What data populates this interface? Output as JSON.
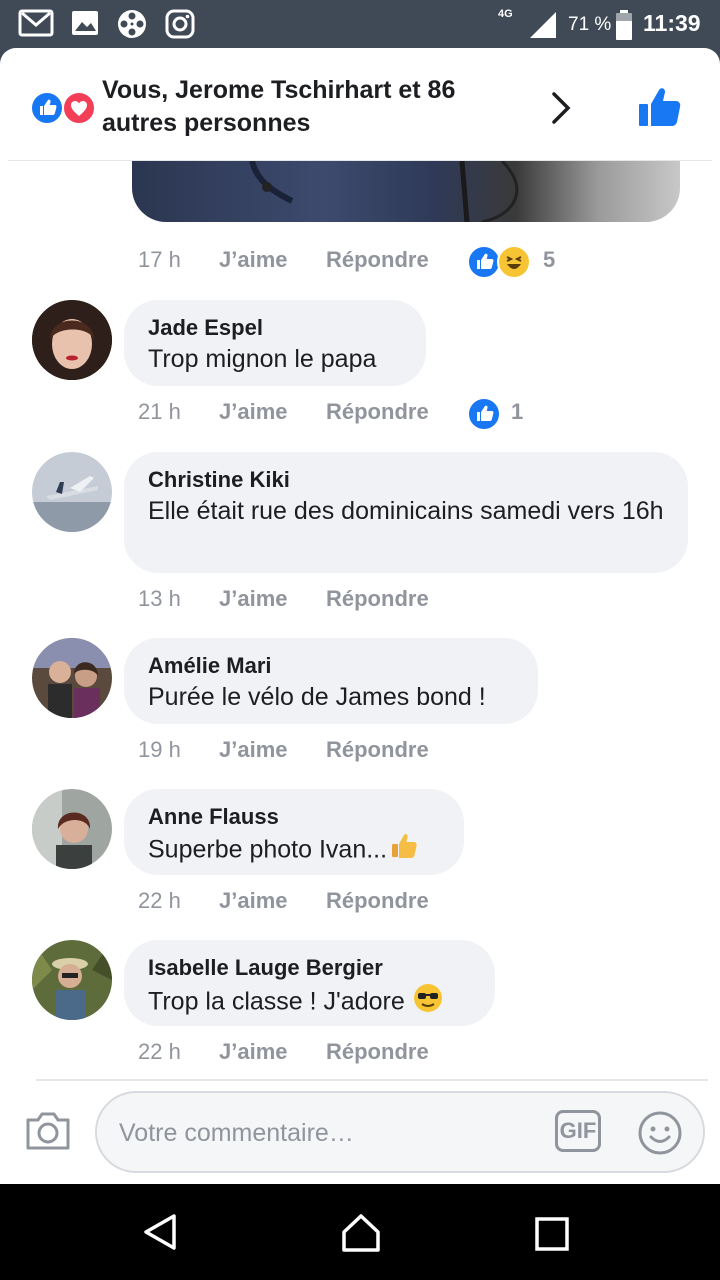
{
  "status_bar": {
    "network": "4G",
    "battery": "71 %",
    "time": "11:39",
    "icons": [
      "gmail-icon",
      "gallery-icon",
      "film-reel-icon",
      "instagram-icon",
      "signal-icon",
      "battery-icon"
    ]
  },
  "header": {
    "reactors_text": "Vous, Jerome Tschirhart et 86 autres personnes",
    "reaction_icons": [
      "like-icon",
      "love-icon"
    ]
  },
  "post_meta": {
    "time": "17 h",
    "like_label": "J’aime",
    "reply_label": "Répondre",
    "reaction_count": "5"
  },
  "comments": [
    {
      "name": "Jade Espel",
      "text": "Trop mignon le papa",
      "time": "21 h",
      "like_label": "J’aime",
      "reply_label": "Répondre",
      "reaction_count": "1"
    },
    {
      "name": "Christine Kiki",
      "text": "Elle était rue des dominicains samedi vers 16h",
      "time": "13 h",
      "like_label": "J’aime",
      "reply_label": "Répondre"
    },
    {
      "name": "Amélie Mari",
      "text": "Purée le vélo de James bond !",
      "time": "19 h",
      "like_label": "J’aime",
      "reply_label": "Répondre"
    },
    {
      "name": "Anne Flauss",
      "text": "Superbe photo Ivan...",
      "time": "22 h",
      "like_label": "J’aime",
      "reply_label": "Répondre"
    },
    {
      "name": "Isabelle Lauge Bergier",
      "text": "Trop la classe ! J'adore",
      "time": "22 h",
      "like_label": "J’aime",
      "reply_label": "Répondre"
    }
  ],
  "composer": {
    "placeholder": "Votre commentaire…",
    "gif_label": "GIF"
  },
  "colors": {
    "accent": "#1877f2",
    "love": "#f33e58",
    "status_bar": "#404a56",
    "bubble": "#f0f2f5"
  }
}
